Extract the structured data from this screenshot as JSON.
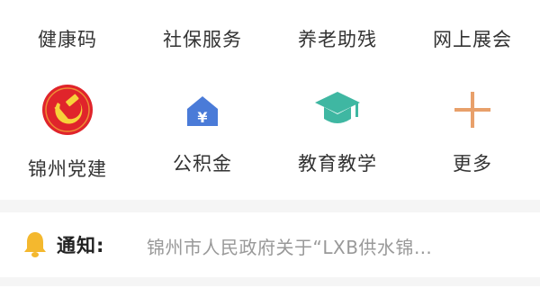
{
  "services_row1": [
    {
      "label": "健康码",
      "icon": "health-code-icon"
    },
    {
      "label": "社保服务",
      "icon": "social-security-icon"
    },
    {
      "label": "养老助残",
      "icon": "elderly-care-icon"
    },
    {
      "label": "网上展会",
      "icon": "online-expo-icon"
    }
  ],
  "services_row2": [
    {
      "label": "锦州党建",
      "icon": "party-emblem-icon"
    },
    {
      "label": "公积金",
      "icon": "housing-fund-icon"
    },
    {
      "label": "教育教学",
      "icon": "graduation-cap-icon"
    },
    {
      "label": "更多",
      "icon": "plus-icon"
    }
  ],
  "notice": {
    "label": "通知:",
    "text": "锦州市人民政府关于“LXB供水锦…",
    "icon": "bell-icon"
  },
  "colors": {
    "health_blue": "#2f8fe8",
    "social_green": "#47b36b",
    "elderly_orange": "#f08a5d",
    "expo_yellow": "#f2c14e",
    "party_red": "#e0242b",
    "party_gold": "#f7d23a",
    "fund_blue": "#4a7bd8",
    "edu_teal": "#3fb7a2",
    "more_orange": "#e8a06a",
    "bell_yellow": "#f4b82e"
  }
}
